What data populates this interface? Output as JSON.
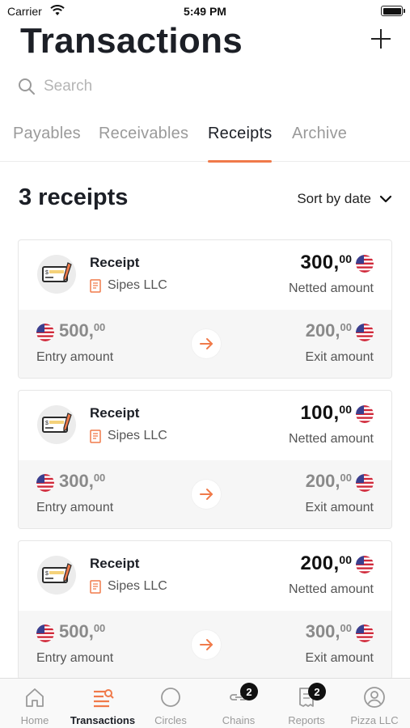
{
  "status_bar": {
    "carrier": "Carrier",
    "time": "5:49 PM"
  },
  "header": {
    "title": "Transactions"
  },
  "search": {
    "placeholder": "Search"
  },
  "tabs": [
    {
      "label": "Payables",
      "active": false
    },
    {
      "label": "Receivables",
      "active": false
    },
    {
      "label": "Receipts",
      "active": true
    },
    {
      "label": "Archive",
      "active": false
    }
  ],
  "list": {
    "count_label": "3 receipts",
    "sort_label": "Sort by date"
  },
  "cards": [
    {
      "title": "Receipt",
      "company": "Sipes LLC",
      "netted_int": "300,",
      "netted_dec": "00",
      "netted_label": "Netted amount",
      "entry_int": "500,",
      "entry_dec": "00",
      "entry_label": "Entry amount",
      "exit_int": "200,",
      "exit_dec": "00",
      "exit_label": "Exit amount"
    },
    {
      "title": "Receipt",
      "company": "Sipes LLC",
      "netted_int": "100,",
      "netted_dec": "00",
      "netted_label": "Netted amount",
      "entry_int": "300,",
      "entry_dec": "00",
      "entry_label": "Entry amount",
      "exit_int": "200,",
      "exit_dec": "00",
      "exit_label": "Exit amount"
    },
    {
      "title": "Receipt",
      "company": "Sipes LLC",
      "netted_int": "200,",
      "netted_dec": "00",
      "netted_label": "Netted amount",
      "entry_int": "500,",
      "entry_dec": "00",
      "entry_label": "Entry amount",
      "exit_int": "300,",
      "exit_dec": "00",
      "exit_label": "Exit amount"
    }
  ],
  "tab_bar": [
    {
      "label": "Home",
      "icon": "home-icon"
    },
    {
      "label": "Transactions",
      "icon": "transactions-icon",
      "active": true
    },
    {
      "label": "Circles",
      "icon": "circle-icon"
    },
    {
      "label": "Chains",
      "icon": "chains-icon",
      "badge": "2"
    },
    {
      "label": "Reports",
      "icon": "reports-icon",
      "badge": "2"
    },
    {
      "label": "Pizza LLC",
      "icon": "profile-icon"
    }
  ],
  "colors": {
    "accent": "#f07a4a",
    "text_dark": "#1c1f26",
    "muted": "#9a9a9a",
    "card_bottom": "#f6f6f6"
  }
}
